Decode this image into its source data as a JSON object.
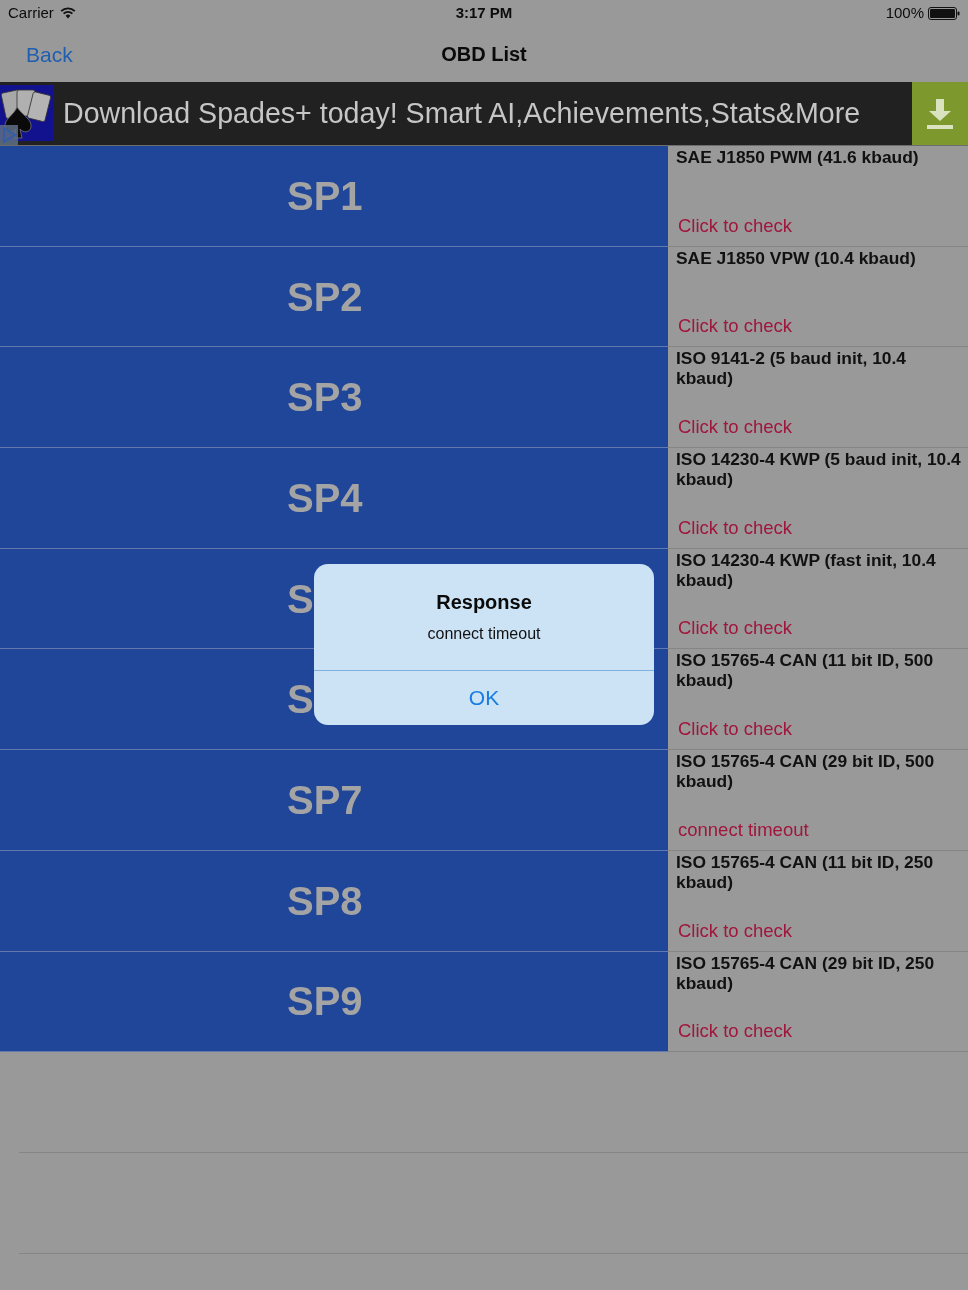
{
  "status_bar": {
    "carrier": "Carrier",
    "time": "3:17 PM",
    "battery": "100%"
  },
  "nav_bar": {
    "back": "Back",
    "title": "OBD List"
  },
  "ad_banner": {
    "text": "Download Spades+ today! Smart AI,Achievements,Stats&More"
  },
  "rows": [
    {
      "label": "SP1",
      "protocol": "SAE J1850 PWM (41.6 kbaud)",
      "status": "Click to check"
    },
    {
      "label": "SP2",
      "protocol": "SAE J1850 VPW (10.4 kbaud)",
      "status": "Click to check"
    },
    {
      "label": "SP3",
      "protocol": "ISO 9141-2 (5 baud init, 10.4 kbaud)",
      "status": "Click to check"
    },
    {
      "label": "SP4",
      "protocol": "ISO 14230-4 KWP (5 baud init, 10.4 kbaud)",
      "status": "Click to check"
    },
    {
      "label": "S",
      "protocol": "ISO 14230-4 KWP (fast init, 10.4 kbaud)",
      "status": "Click to check"
    },
    {
      "label": "S",
      "protocol": "ISO 15765-4 CAN (11 bit ID, 500 kbaud)",
      "status": "Click to check"
    },
    {
      "label": "SP7",
      "protocol": "ISO 15765-4 CAN (29 bit ID, 500 kbaud)",
      "status": "connect timeout"
    },
    {
      "label": "SP8",
      "protocol": "ISO 15765-4 CAN (11 bit ID, 250 kbaud)",
      "status": "Click to check"
    },
    {
      "label": "SP9",
      "protocol": "ISO 15765-4 CAN (29 bit ID, 250 kbaud)",
      "status": "Click to check"
    }
  ],
  "alert": {
    "title": "Response",
    "message": "connect timeout",
    "button": "OK"
  }
}
